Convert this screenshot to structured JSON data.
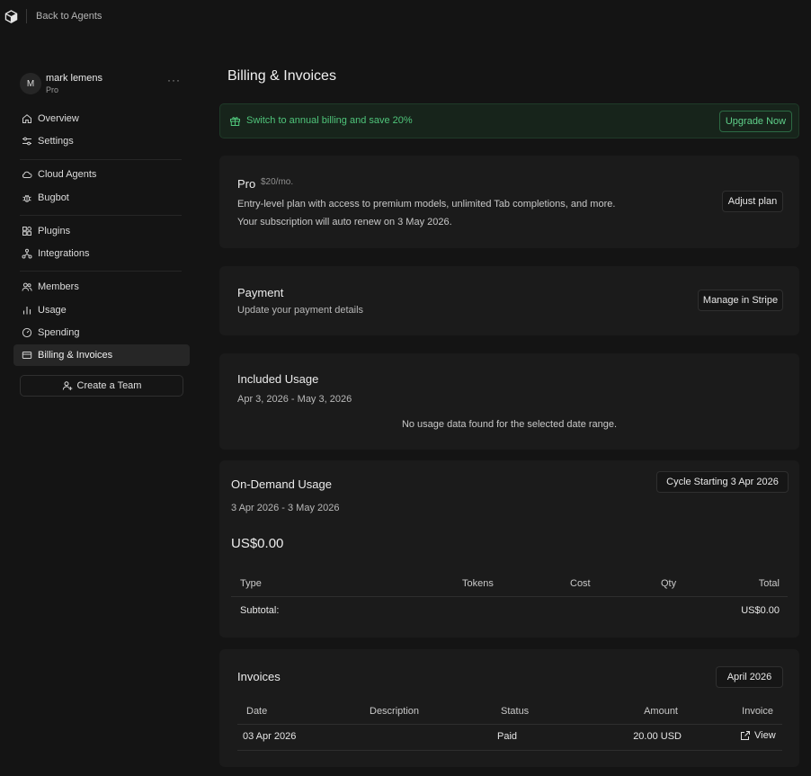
{
  "topbar": {
    "logo_icon": "cube-logo-icon",
    "back_label": "Back to Agents"
  },
  "sidebar": {
    "user": {
      "initial": "M",
      "name": "mark lemens",
      "plan": "Pro",
      "more": "···"
    },
    "items": [
      {
        "label": "Overview",
        "icon": "home-icon"
      },
      {
        "label": "Settings",
        "icon": "sliders-icon"
      },
      {
        "label": "Cloud Agents",
        "icon": "cloud-icon"
      },
      {
        "label": "Bugbot",
        "icon": "bug-icon"
      },
      {
        "label": "Plugins",
        "icon": "puzzle-icon"
      },
      {
        "label": "Integrations",
        "icon": "network-icon"
      },
      {
        "label": "Members",
        "icon": "users-icon"
      },
      {
        "label": "Usage",
        "icon": "bar-chart-icon"
      },
      {
        "label": "Spending",
        "icon": "gauge-icon"
      },
      {
        "label": "Billing & Invoices",
        "icon": "credit-card-icon"
      }
    ],
    "active_item": "Billing & Invoices",
    "create_team_label": "Create a Team"
  },
  "main": {
    "title": "Billing & Invoices",
    "banner": {
      "text": "Switch to annual billing and save 20%",
      "button": "Upgrade Now",
      "color": "#4fc47a"
    },
    "plan": {
      "name": "Pro",
      "price": "$20/mo.",
      "description": "Entry-level plan with access to premium models, unlimited Tab completions, and more.",
      "renewal": "Your subscription will auto renew on 3 May 2026.",
      "button": "Adjust plan"
    },
    "payment": {
      "title": "Payment",
      "subtitle": "Update your payment details",
      "button": "Manage in Stripe"
    },
    "included_usage": {
      "title": "Included Usage",
      "range": "Apr 3, 2026 - May 3, 2026",
      "empty": "No usage data found for the selected date range."
    },
    "on_demand": {
      "title": "On-Demand Usage",
      "range": "3 Apr 2026 - 3 May 2026",
      "cycle_button": "Cycle Starting 3 Apr 2026",
      "amount": "US$0.00",
      "columns": [
        "Type",
        "Tokens",
        "Cost",
        "Qty",
        "Total"
      ],
      "subtotal_label": "Subtotal:",
      "subtotal_value": "US$0.00"
    },
    "invoices": {
      "title": "Invoices",
      "month_button": "April 2026",
      "columns": [
        "Date",
        "Description",
        "Status",
        "Amount",
        "Invoice"
      ],
      "rows": [
        {
          "date": "03 Apr 2026",
          "description": "",
          "status": "Paid",
          "amount": "20.00 USD",
          "invoice": "View"
        }
      ]
    }
  }
}
